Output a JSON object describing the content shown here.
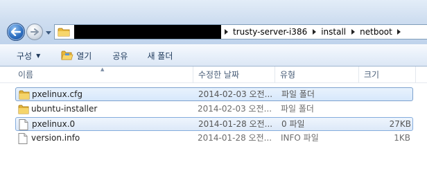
{
  "address": {
    "breadcrumbs": [
      "trusty-server-i386",
      "install",
      "netboot"
    ]
  },
  "toolbar": {
    "organize_label": "구성",
    "open_label": "열기",
    "share_label": "공유",
    "new_folder_label": "새 폴더"
  },
  "columns": {
    "name": "이름",
    "date_modified": "수정한 날짜",
    "type": "유형",
    "size": "크기"
  },
  "files": [
    {
      "name": "pxelinux.cfg",
      "date": "2014-02-03 오전...",
      "type": "파일 폴더",
      "size": "",
      "icon": "folder-icon",
      "state": "selected"
    },
    {
      "name": "ubuntu-installer",
      "date": "2014-02-03 오전...",
      "type": "파일 폴더",
      "size": "",
      "icon": "folder-icon",
      "state": "normal"
    },
    {
      "name": "pxelinux.0",
      "date": "2014-01-28 오전...",
      "type": "0 파일",
      "size": "27KB",
      "icon": "file-icon",
      "state": "focused"
    },
    {
      "name": "version.info",
      "date": "2014-01-28 오전...",
      "type": "INFO 파일",
      "size": "1KB",
      "icon": "file-icon",
      "state": "normal"
    }
  ]
}
